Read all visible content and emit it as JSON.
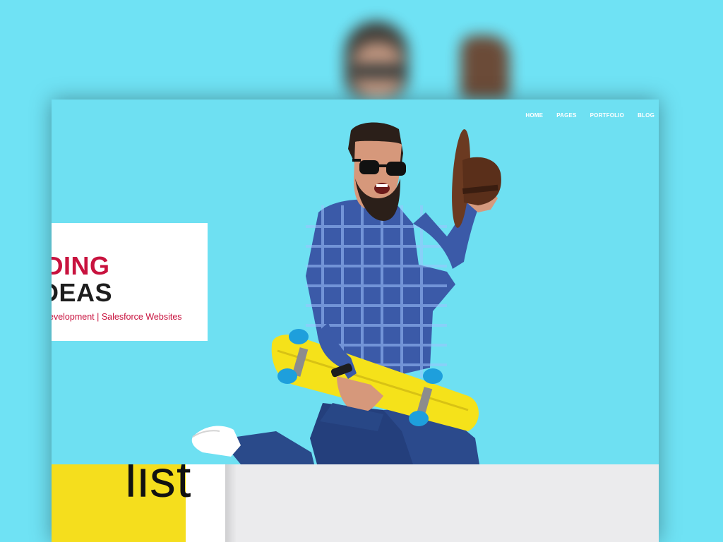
{
  "nav": {
    "items": [
      {
        "label": "HOME"
      },
      {
        "label": "PAGES"
      },
      {
        "label": "PORTFOLIO"
      },
      {
        "label": "BLOG"
      }
    ]
  },
  "hero": {
    "line1": "NDING",
    "line2": "DEAS",
    "subtitle": "evelopment | Salesforce Websites"
  },
  "bottom_section": {
    "word": "list"
  },
  "colors": {
    "background": "#6fe2f4",
    "accent_red": "#c8123e",
    "skateboard_yellow": "#f5de1d"
  },
  "icons": {
    "hero_image": "man-with-skateboard-photo"
  }
}
